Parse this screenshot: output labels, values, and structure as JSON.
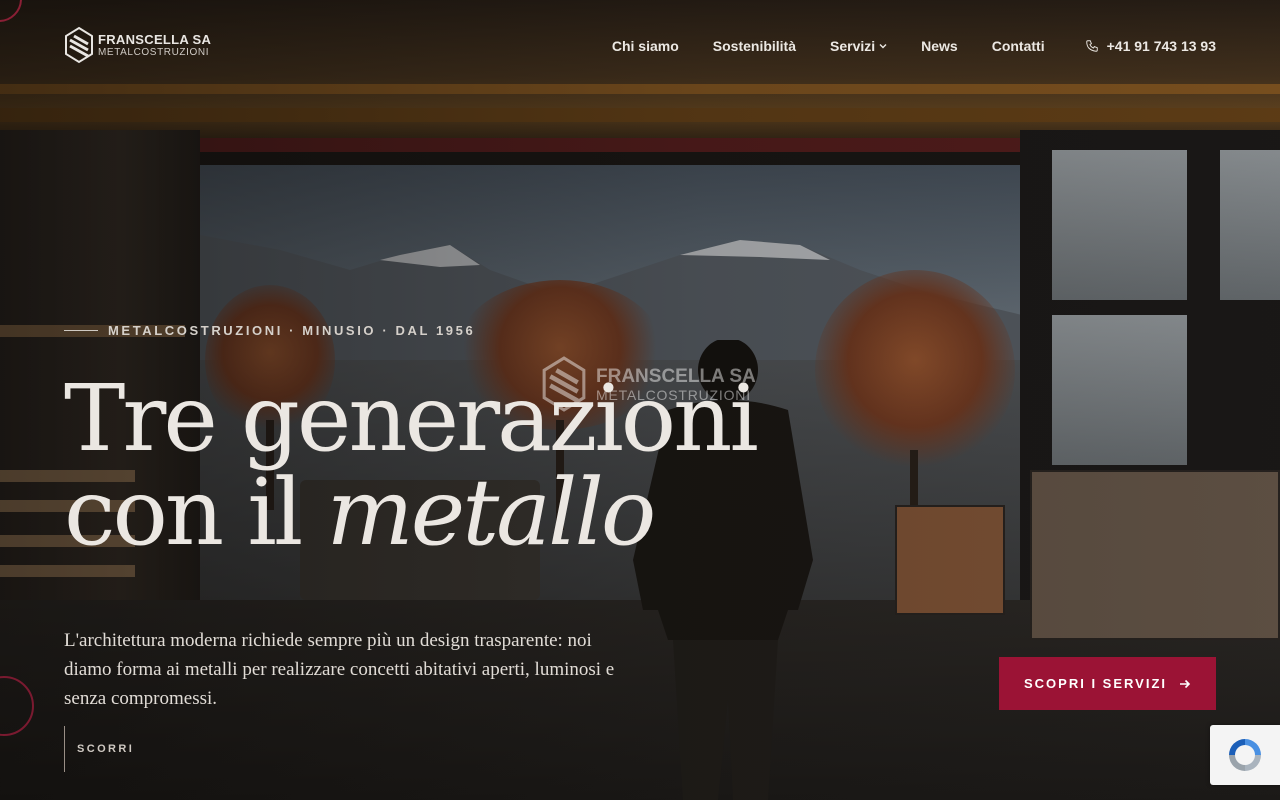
{
  "brand": {
    "name": "FRANSCELLA SA",
    "subtitle": "METALCOSTRUZIONI"
  },
  "nav": {
    "items": [
      {
        "label": "Chi siamo"
      },
      {
        "label": "Sostenibilità"
      },
      {
        "label": "Servizi",
        "has_dropdown": true
      },
      {
        "label": "News"
      },
      {
        "label": "Contatti"
      }
    ],
    "phone": "+41 91 743 13 93"
  },
  "hero": {
    "eyebrow": "METALCOSTRUZIONI · MINUSIO · DAL 1956",
    "headline_line1": "Tre generazioni",
    "headline_line2_prefix": "con il ",
    "headline_line2_emphasis": "metallo",
    "lead": "L'architettura moderna richiede sempre più un design trasparente: noi diamo forma ai metalli per realizzare concetti abitativi aperti, luminosi e senza compromessi.",
    "cta_label": "SCOPRI I SERVIZI",
    "scroll_label": "SCORRI"
  },
  "watermark": {
    "name": "FRANSCELLA SA",
    "subtitle": "METALCOSTRUZIONI"
  },
  "colors": {
    "accent": "#9b1335",
    "text": "#ebe7e2"
  },
  "icons": {
    "phone": "phone-icon",
    "chevron": "chevron-down-icon",
    "arrow": "arrow-right-icon",
    "recaptcha": "recaptcha-icon"
  }
}
